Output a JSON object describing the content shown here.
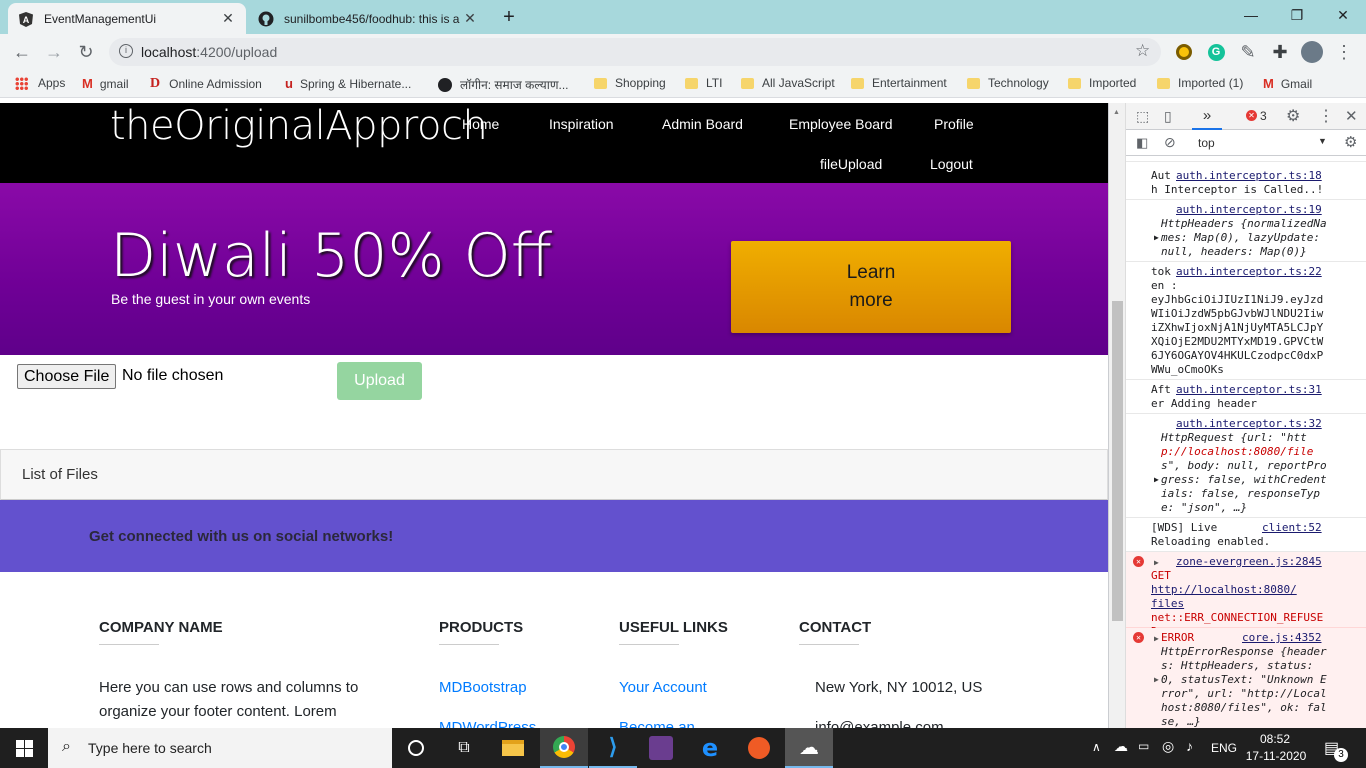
{
  "browser": {
    "tabs": [
      {
        "title": "EventManagementUi"
      },
      {
        "title": "sunilbombe456/foodhub: this is a"
      }
    ],
    "new_tab": "+",
    "window_controls": {
      "minimize": "—",
      "restore": "❐",
      "close": "✕"
    },
    "address": {
      "host": "localhost",
      "path": ":4200/upload"
    },
    "profile_initial": "C"
  },
  "bookmarks": [
    {
      "label": "Apps"
    },
    {
      "label": "gmail"
    },
    {
      "label": "Online Admission"
    },
    {
      "label": "Spring & Hibernate..."
    },
    {
      "label": "लॉगीन: समाज कल्याण..."
    },
    {
      "label": "Shopping"
    },
    {
      "label": "LTI"
    },
    {
      "label": "All JavaScript"
    },
    {
      "label": "Entertainment"
    },
    {
      "label": "Technology"
    },
    {
      "label": "Imported"
    },
    {
      "label": "Imported (1)"
    },
    {
      "label": "Gmail"
    }
  ],
  "page": {
    "brand": "theOriginalApproch",
    "nav": [
      "Home",
      "Inspiration",
      "Admin Board",
      "Employee Board",
      "Profile",
      "fileUpload",
      "Logout"
    ],
    "hero": {
      "title": "Diwali 50% Off",
      "subtitle": "Be the guest in your own events",
      "cta": "Learn more"
    },
    "file_input": {
      "button": "Choose File",
      "status": "No file chosen"
    },
    "upload_button": "Upload",
    "list_header": "List of Files",
    "social_text": "Get connected with us on social networks!",
    "footer": {
      "company_heading": "COMPANY NAME",
      "company_text_1": "Here you can use rows and columns to",
      "company_text_2": "organize your footer content. Lorem",
      "products_heading": "PRODUCTS",
      "products": [
        "MDBootstrap",
        "MDWordPress"
      ],
      "links_heading": "USEFUL LINKS",
      "links": [
        "Your Account",
        "Become an"
      ],
      "contact_heading": "CONTACT",
      "contact": [
        "New York, NY 10012, US",
        "info@example.com"
      ]
    }
  },
  "devtools": {
    "more_tabs": "»",
    "error_count": "3",
    "context": "top",
    "console": [
      {
        "src": "auth.interceptor.ts:18",
        "pre": "Aut",
        "text": "h Interceptor is Called..!"
      },
      {
        "src": "auth.interceptor.ts:19",
        "l1": "HttpHeaders {normalizedNa",
        "l2": "mes: Map(0), lazyUpdate:",
        "l3": "null, headers: Map(0)}"
      },
      {
        "src": "auth.interceptor.ts:22",
        "pre": "tok",
        "l1": "en :",
        "l2": "eyJhbGciOiJIUzI1NiJ9.eyJzd",
        "l3": "WIiOiJzdW5pbGJvbWJlNDU2Iiw",
        "l4": "iZXhwIjoxNjA1NjUyMTA5LCJpY",
        "l5": "XQiOjE2MDU2MTYxMD19.GPVCtW",
        "l6": "6JY6OGAYOV4HKULCzodpcC0dxP",
        "l7": "WWu_oCmoOKs"
      },
      {
        "src": "auth.interceptor.ts:31",
        "pre": "Aft",
        "text": "er Adding header"
      },
      {
        "src": "auth.interceptor.ts:32",
        "l1": "HttpRequest {url: \"htt",
        "l2": "p://localhost:8080/file",
        "l3": "s\", body: null, reportPro",
        "l4": "gress: false, withCredent",
        "l5": "ials: false, responseTyp",
        "l6": "e: \"json\", …}"
      },
      {
        "src": "client:52",
        "pre": "[WDS] Live",
        "text": "Reloading enabled."
      },
      {
        "src": "zone-evergreen.js:2845",
        "l1": "GET",
        "l2": "http://localhost:8080/",
        "l3": "files",
        "l4": "net::ERR_CONNECTION_REFUSE",
        "l5": "D"
      },
      {
        "src": "core.js:4352",
        "label": "ERROR",
        "l1": "HttpErrorResponse {header",
        "l2": "s: HttpHeaders, status:",
        "l3": "0, statusText: \"Unknown E",
        "l4": "rror\", url: \"http://Local",
        "l5": "host:8080/files\", ok: fal",
        "l6": "se, …}"
      }
    ]
  },
  "taskbar": {
    "search_placeholder": "Type here to search",
    "language": "ENG",
    "time": "08:52",
    "date": "17-11-2020",
    "notification_count": "3"
  }
}
